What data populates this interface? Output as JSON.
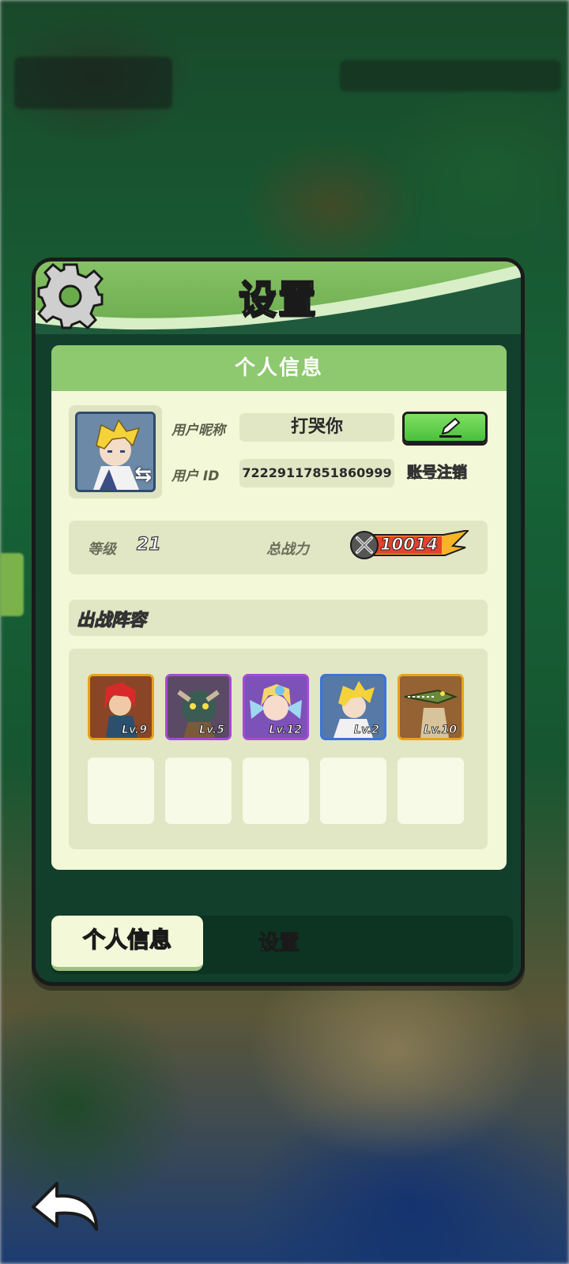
{
  "dialog": {
    "title": "设置",
    "panel_title": "个人信息"
  },
  "profile": {
    "nickname_label": "用户昵称",
    "nickname": "打哭你",
    "id_label": "用户  ID",
    "user_id": "72229117851860999",
    "cancel_account_label": "账号注销",
    "level_label": "等级",
    "level": "21",
    "power_label": "总战力",
    "power": "10014"
  },
  "lineup": {
    "title": "出战阵容",
    "heroes": [
      {
        "level": "Lv.9",
        "rarity": "orange"
      },
      {
        "level": "Lv.5",
        "rarity": "purple"
      },
      {
        "level": "Lv.12",
        "rarity": "purple"
      },
      {
        "level": "Lv.2",
        "rarity": "blue"
      },
      {
        "level": "Lv.10",
        "rarity": "orange"
      }
    ],
    "empty_slots": 5
  },
  "tabs": [
    {
      "label": "个人信息",
      "active": true
    },
    {
      "label": "设置",
      "active": false
    }
  ],
  "colors": {
    "header_green": "#86c166",
    "panel_bg": "#f3f8d8",
    "edit_button": "#4bbf3c",
    "orange_frame": "#e9a21a",
    "purple_frame": "#a64ad6",
    "blue_frame": "#3b73d8"
  },
  "icons": {
    "settings": "gear-icon",
    "edit": "pencil-icon",
    "swap": "swap-icon",
    "power": "crossed-swords-icon",
    "back": "back-arrow-icon"
  }
}
